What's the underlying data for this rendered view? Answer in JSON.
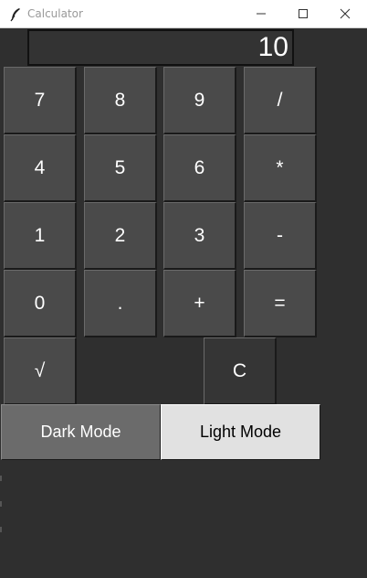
{
  "window": {
    "title": "Calculator"
  },
  "display": {
    "value": "10"
  },
  "keys": {
    "seven": "7",
    "eight": "8",
    "nine": "9",
    "divide": "/",
    "four": "4",
    "five": "5",
    "six": "6",
    "multiply": "*",
    "one": "1",
    "two": "2",
    "three": "3",
    "subtract": "-",
    "zero": "0",
    "decimal": ".",
    "add": "+",
    "equals": "=",
    "sqrt": "√",
    "clear": "C"
  },
  "modes": {
    "dark": "Dark Mode",
    "light": "Light Mode"
  },
  "icons": {
    "app": "feather-icon",
    "minimize": "minimize-icon",
    "maximize": "maximize-icon",
    "close": "close-icon"
  },
  "colors": {
    "background": "#2f2f2f",
    "key": "#4a4a4a",
    "dark_mode_button": "#6b6b6b",
    "light_mode_button": "#e1e1e1"
  }
}
